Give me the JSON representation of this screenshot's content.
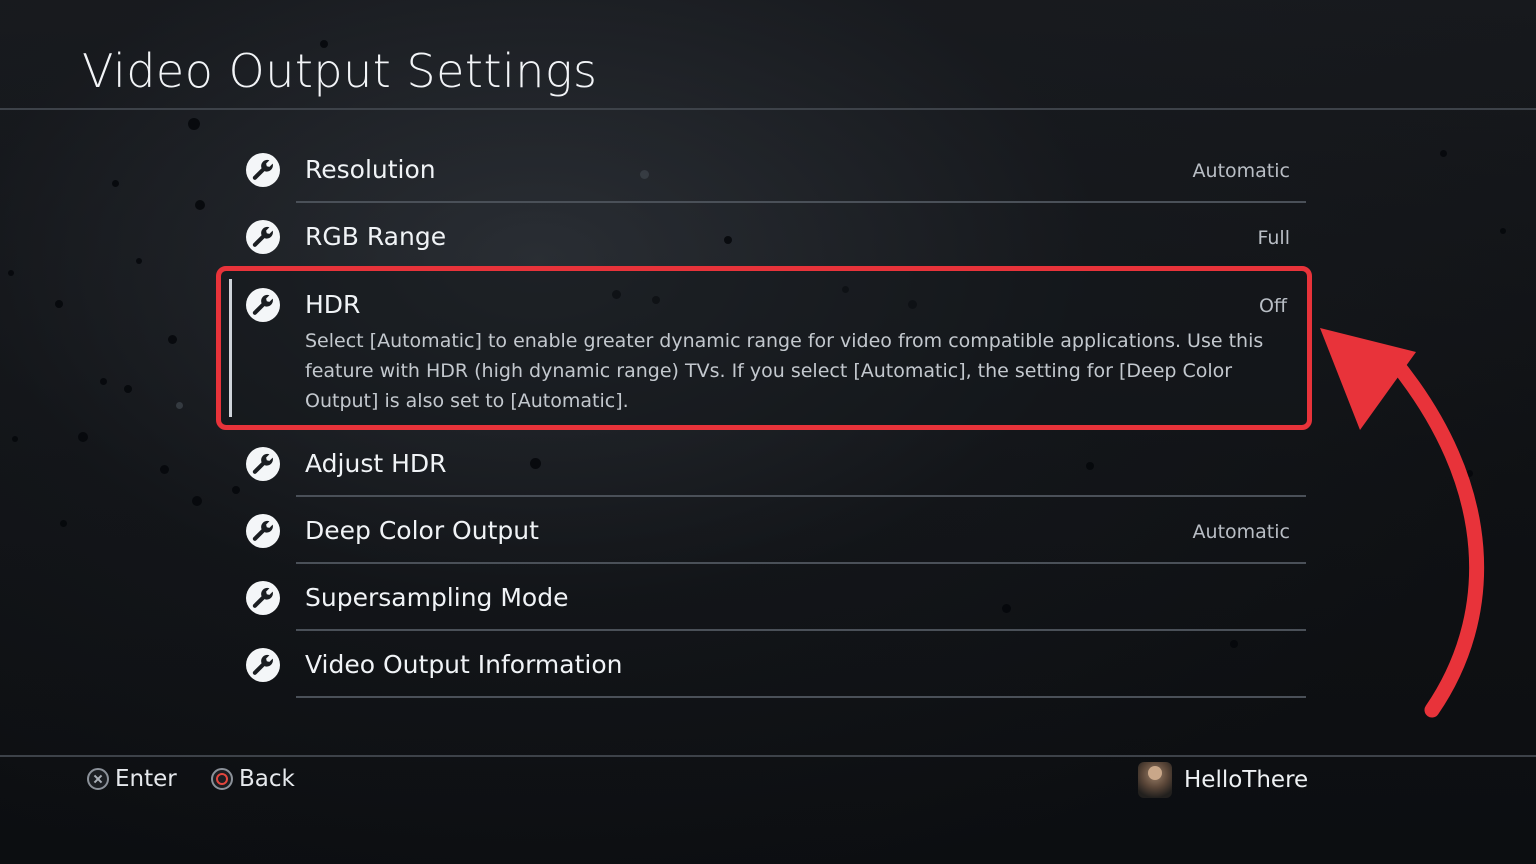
{
  "screen": {
    "title": "Video Output Settings"
  },
  "menu": {
    "items": [
      {
        "label": "Resolution",
        "value": "Automatic"
      },
      {
        "label": "RGB Range",
        "value": "Full"
      },
      {
        "label": "HDR",
        "value": "Off",
        "description": "Select [Automatic] to enable greater dynamic range for video from compatible applications. Use this feature with HDR (high dynamic range) TVs. If you select [Automatic], the setting for [Deep Color Output] is also set to [Automatic]."
      },
      {
        "label": "Adjust HDR",
        "value": ""
      },
      {
        "label": "Deep Color Output",
        "value": "Automatic"
      },
      {
        "label": "Supersampling Mode",
        "value": ""
      },
      {
        "label": "Video Output Information",
        "value": ""
      }
    ],
    "icon": "wrench-icon"
  },
  "footer": {
    "enter_label": "Enter",
    "back_label": "Back",
    "user_name": "HelloThere"
  },
  "colors": {
    "highlight_border": "#e8333a",
    "annotation_arrow": "#e8333a",
    "text_primary": "#f0f3f6",
    "text_secondary": "#b9bec5"
  }
}
